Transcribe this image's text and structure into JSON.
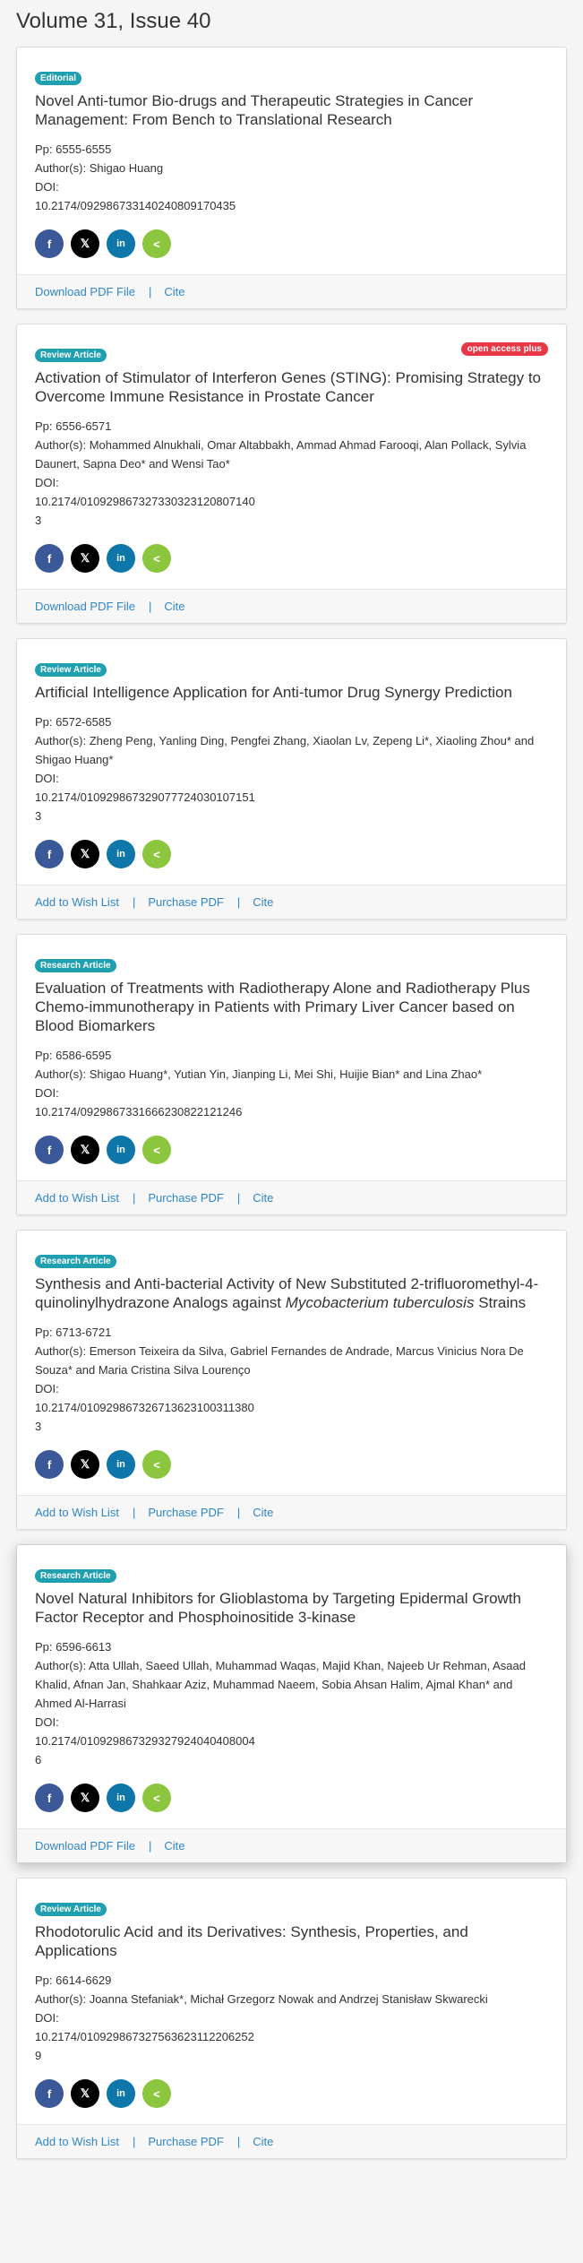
{
  "page_title": "Volume 31, Issue 40",
  "labels": {
    "pp": "Pp: ",
    "authors": "Author(s): ",
    "doi": "DOI:",
    "download": "Download PDF File",
    "cite": "Cite",
    "wish": "Add to Wish List",
    "purchase": "Purchase PDF",
    "separator": "|",
    "open_access": "open access plus",
    "share_icons": {
      "facebook": "f",
      "x": "𝕏",
      "linkedin": "in",
      "share": "<"
    }
  },
  "articles": [
    {
      "type": "Editorial",
      "title": "Novel Anti-tumor Bio-drugs and Therapeutic Strategies in Cancer Management: From Bench to Translational Research",
      "pages": "6555-6555",
      "authors": "Shigao Huang",
      "doi": "10.2174/0929867331402408091704​35",
      "count": "",
      "footer": "download"
    },
    {
      "type": "Review Article",
      "open_access": true,
      "title": "Activation of Stimulator of Interferon Genes (STING): Promising Strategy to Overcome Immune Resistance in Prostate Cancer",
      "pages": "6556-6571",
      "authors": "Mohammed Alnukhali, Omar Altabbakh, Ammad Ahmad Farooqi, Alan Pollack, Sylvia Daunert, Sapna Deo* and Wensi Tao*",
      "doi": "10.2174/0109298673273303231208071​40",
      "count": "3",
      "footer": "download"
    },
    {
      "type": "Review Article",
      "title": "Artificial Intelligence Application for Anti-tumor Drug Synergy Prediction",
      "pages": "6572-6585",
      "authors": "Zheng Peng, Yanling Ding, Pengfei Zhang, Xiaolan Lv, Zepeng Li*, Xiaoling Zhou* and Shigao Huang*",
      "doi": "10.2174/0109298673290777240301071​51",
      "count": "3",
      "footer": "purchase"
    },
    {
      "type": "Research Article",
      "title": "Evaluation of Treatments with Radiotherapy Alone and Radiotherapy Plus Chemo-immunotherapy in Patients with Primary Liver Cancer based on Blood Biomarkers",
      "pages": "6586-6595",
      "authors": "Shigao Huang*, Yutian Yin, Jianping Li, Mei Shi, Huijie Bian* and Lina Zhao*",
      "doi": "10.2174/0929867331666230822121246",
      "count": "",
      "footer": "purchase"
    },
    {
      "type": "Research Article",
      "title_parts": [
        "Synthesis and Anti-bacterial Activity of New Substituted 2-trifluoromethyl-4-quinolinylhydrazone Analogs against ",
        "Mycobacterium tuberculosis",
        " Strains"
      ],
      "pages": "6713-6721",
      "authors": "Emerson Teixeira da Silva, Gabriel Fernandes de Andrade, Marcus Vinicius Nora De Souza* and Maria Cristina Silva Lourenço",
      "doi": "10.2174/0109298673267136231003113​80",
      "count": "3",
      "footer": "purchase"
    },
    {
      "type": "Research Article",
      "raised": true,
      "title": "Novel Natural Inhibitors for Glioblastoma by Targeting Epidermal Growth Factor Receptor and Phosphoinositide 3-kinase",
      "pages": "6596-6613",
      "authors": "Atta Ullah, Saeed Ullah, Muhammad Waqas, Majid Khan, Najeeb Ur Rehman, Asaad Khalid, Afnan Jan, Shahkaar Aziz, Muhammad Naeem, Sobia Ahsan Halim, Ajmal Khan* and Ahmed Al-Harrasi",
      "doi": "10.2174/0109298673293279240404080​04",
      "count": "6",
      "footer": "download"
    },
    {
      "type": "Review Article",
      "title": "Rhodotorulic Acid and its Derivatives: Synthesis, Properties, and Applications",
      "pages": "6614-6629",
      "authors": "Joanna Stefaniak*, Michał Grzegorz Nowak and Andrzej Stanisław Skwarecki",
      "doi": "10.2174/0109298673275636231122062​52",
      "count": "9",
      "footer": "purchase"
    }
  ]
}
